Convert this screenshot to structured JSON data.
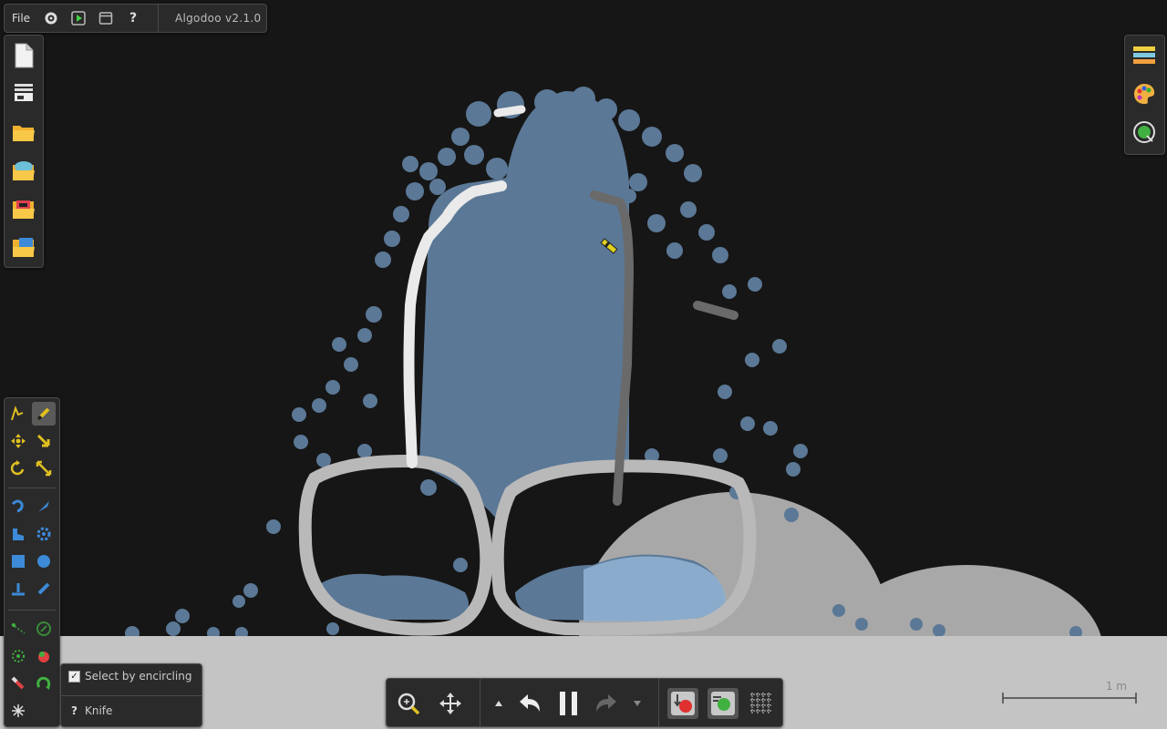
{
  "app": {
    "title": "Algodoo v2.1.0"
  },
  "menubar": {
    "file_label": "File",
    "icons": [
      "settings-gear-icon",
      "play-icon",
      "window-icon",
      "help-icon"
    ],
    "help_label": "?"
  },
  "left_toolbar": {
    "buttons": [
      "new-scene-icon",
      "browse-scenes-icon",
      "open-folder-icon",
      "open-algobox-icon",
      "open-phunlet-icon",
      "save-icon"
    ]
  },
  "right_toolbar": {
    "buttons": [
      "layers-icon",
      "palette-icon",
      "materials-icon"
    ]
  },
  "tool_palette": {
    "tools": [
      "sketch-tool",
      "brush-tool",
      "move-tool",
      "drag-tool",
      "rotate-tool",
      "scale-tool",
      "rope-tool",
      "knife-tool",
      "plane-tool",
      "gear-tool",
      "box-tool",
      "circle-tool",
      "fixate-tool",
      "laser-tool",
      "chain-tool",
      "spring-tool",
      "thruster-tool",
      "tracer-tool",
      "pen-tool",
      "hinge-tool",
      "fan-tool"
    ],
    "active_tool": "brush-tool"
  },
  "tool_options": {
    "select_by_encircling_label": "Select by encircling",
    "select_by_encircling_checked": true,
    "help_symbol": "?",
    "tool_name": "Knife"
  },
  "bottom_toolbar": {
    "buttons": [
      "zoom-icon",
      "pan-icon",
      "menu-up-icon",
      "undo-icon",
      "pause-icon",
      "redo-icon",
      "menu-down-icon",
      "gravity-icon",
      "air-friction-icon",
      "grid-icon"
    ]
  },
  "scale_bar": {
    "label": "1 m"
  },
  "colors": {
    "background": "#161616",
    "ground": "#c4c4c4",
    "water": "#5b7896",
    "water_light": "#8fb0d0",
    "white_line": "#eaeaea",
    "grey_line": "#6a6a6a",
    "ring": "#b9b9b9",
    "cloud": "#a9a9a9"
  }
}
